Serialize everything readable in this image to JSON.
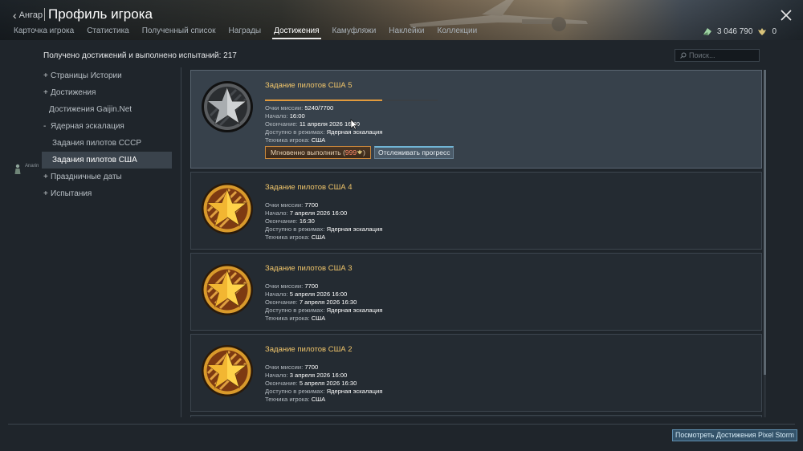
{
  "header": {
    "back_label": "Ангар",
    "title": "Профиль игрока",
    "tabs": [
      {
        "label": "Карточка игрока",
        "active": false
      },
      {
        "label": "Статистика",
        "active": false
      },
      {
        "label": "Полученный список",
        "active": false
      },
      {
        "label": "Награды",
        "active": false
      },
      {
        "label": "Достижения",
        "active": true
      },
      {
        "label": "Камуфляжи",
        "active": false
      },
      {
        "label": "Наклейки",
        "active": false
      },
      {
        "label": "Коллекции",
        "active": false
      }
    ],
    "silver": "3 046 790",
    "gold": "0"
  },
  "summary": "Получено достижений и выполнено испытаний: 217",
  "search": {
    "placeholder": "Поиск..."
  },
  "sidebar": {
    "items": [
      {
        "mark": "+",
        "label": "Страницы Истории"
      },
      {
        "mark": "+",
        "label": "Достижения"
      },
      {
        "mark": "",
        "label": "Достижения Gaijin.Net"
      },
      {
        "mark": "-",
        "label": "Ядерная эскалация"
      },
      {
        "mark": "",
        "label": "Задания пилотов СССР"
      },
      {
        "mark": "",
        "label": "Задания пилотов США",
        "selected": true
      },
      {
        "mark": "+",
        "label": "Праздничные даты"
      },
      {
        "mark": "+",
        "label": "Испытания"
      }
    ],
    "avatar_name": "Anarin"
  },
  "cards": [
    {
      "title": "Задание пилотов США 5",
      "medal": "silver-star-medal",
      "progress_fraction": 0.68,
      "rows": [
        {
          "key": "Очки миссии:",
          "value": "5240/7700"
        },
        {
          "key": "Начало:",
          "value": "16:00"
        },
        {
          "key": "Окончание:",
          "value": "11 апреля 2026 16:30"
        },
        {
          "key": "Доступно в режимах:",
          "value": "Ядерная эскалация"
        },
        {
          "key": "Техника игрока:",
          "value": "США"
        }
      ],
      "complete_label": "Мгновенно выполнить",
      "complete_cost": "999",
      "track_label": "Отслеживать прогресс"
    },
    {
      "title": "Задание пилотов США 4",
      "medal": "gold-star-medal",
      "rows": [
        {
          "key": "Очки миссии:",
          "value": "7700"
        },
        {
          "key": "Начало:",
          "value": "7 апреля 2026 16:00"
        },
        {
          "key": "Окончание:",
          "value": "16:30"
        },
        {
          "key": "Доступно в режимах:",
          "value": "Ядерная эскалация"
        },
        {
          "key": "Техника игрока:",
          "value": "США"
        }
      ]
    },
    {
      "title": "Задание пилотов США 3",
      "medal": "gold-star-medal",
      "rows": [
        {
          "key": "Очки миссии:",
          "value": "7700"
        },
        {
          "key": "Начало:",
          "value": "5 апреля 2026 16:00"
        },
        {
          "key": "Окончание:",
          "value": "7 апреля 2026 16:30"
        },
        {
          "key": "Доступно в режимах:",
          "value": "Ядерная эскалация"
        },
        {
          "key": "Техника игрока:",
          "value": "США"
        }
      ]
    },
    {
      "title": "Задание пилотов США 2",
      "medal": "gold-star-medal",
      "rows": [
        {
          "key": "Очки миссии:",
          "value": "7700"
        },
        {
          "key": "Начало:",
          "value": "3 апреля 2026 16:00"
        },
        {
          "key": "Окончание:",
          "value": "5 апреля 2026 16:30"
        },
        {
          "key": "Доступно в режимах:",
          "value": "Ядерная эскалация"
        },
        {
          "key": "Техника игрока:",
          "value": "США"
        }
      ]
    }
  ],
  "footer": {
    "button_label": "Посмотреть Достижения Pixel Storm"
  },
  "colors": {
    "accent_gold": "#f0c56a",
    "progress": "#e29a3c",
    "track_button": "#4b5b69"
  }
}
